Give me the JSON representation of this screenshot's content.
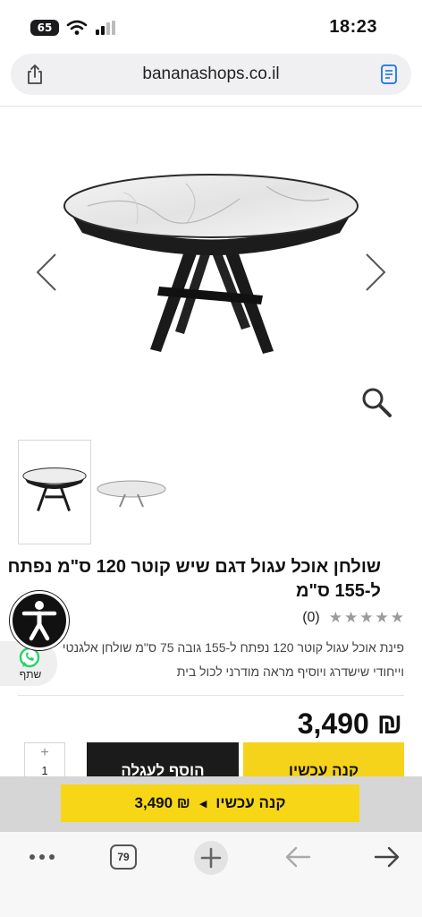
{
  "status": {
    "battery": "65",
    "time": "18:23"
  },
  "browser": {
    "url": "bananashops.co.il",
    "tab_count": "79"
  },
  "product": {
    "title": "שולחן אוכל עגול דגם שיש קוטר 120 ס\"מ נפתח ל-155 ס\"מ",
    "review_count": "(0)",
    "rating": 0,
    "stars_max": 5,
    "description_line1": "פינת אוכל עגול קוטר 120 נפתח ל-155 גובה 75 ס\"מ שולחן אלגנטי",
    "description_line2": "וייחודי שישדרג ויוסיף מראה מודרני לכול בית",
    "price": "3,490 ₪",
    "quantity": "1",
    "qty_plus": "+"
  },
  "buttons": {
    "add_to_cart": "הוסף לעגלה",
    "buy_now": "קנה עכשיו"
  },
  "sticky": {
    "label": "קנה עכשיו",
    "price": "3,490 ₪",
    "separator": "◀"
  },
  "widgets": {
    "whatsapp_label": "שתף"
  },
  "colors": {
    "accent_yellow": "#f5d31a",
    "dark_button": "#1b1b1b",
    "whatsapp_green": "#25d366"
  },
  "icons": {
    "share": "share-icon",
    "reader": "reader-icon",
    "zoom": "zoom-icon",
    "accessibility": "accessibility-icon",
    "whatsapp": "whatsapp-icon"
  }
}
